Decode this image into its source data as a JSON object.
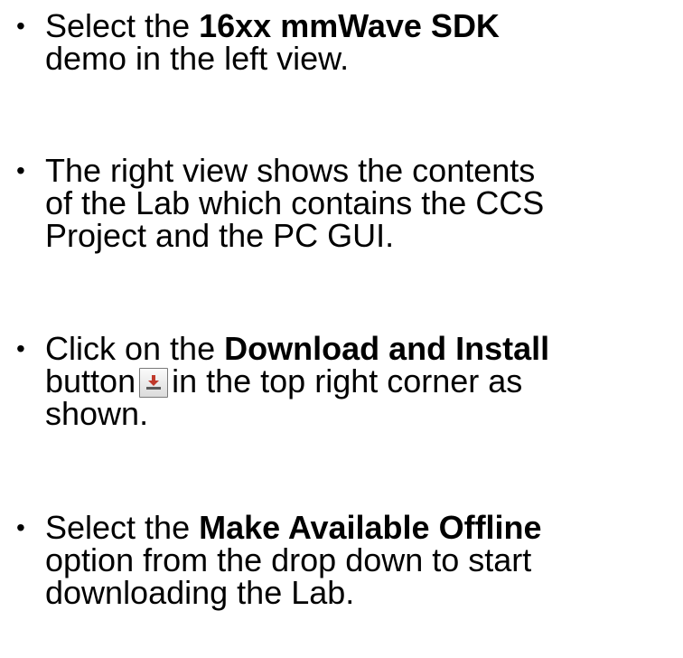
{
  "bullets": [
    {
      "lines": [
        {
          "before": "Select the ",
          "bold": "16xx mmWave SDK",
          "after": ""
        },
        {
          "text": "demo in the left view."
        }
      ]
    },
    {
      "lines": [
        {
          "text": "The right view shows the contents"
        },
        {
          "text": "of the Lab which contains the CCS"
        },
        {
          "text": "Project and the PC GUI."
        }
      ]
    },
    {
      "lines": [
        {
          "before": "Click on the ",
          "bold": "Download and Install",
          "after": ""
        },
        {
          "before": "button",
          "after": "in the top right corner as"
        },
        {
          "text": "shown."
        }
      ],
      "icon": "download-install-icon"
    },
    {
      "lines": [
        {
          "before": "Select the ",
          "bold": "Make Available Offline",
          "after": ""
        },
        {
          "text": "option from the drop down to start"
        },
        {
          "text": "downloading the Lab."
        }
      ]
    }
  ],
  "bullet_glyph": "•",
  "colors": {
    "text": "#000000",
    "icon_arrow": "#c0392b",
    "icon_tray": "#5a5a5a",
    "button_border": "#7a7a7a"
  }
}
